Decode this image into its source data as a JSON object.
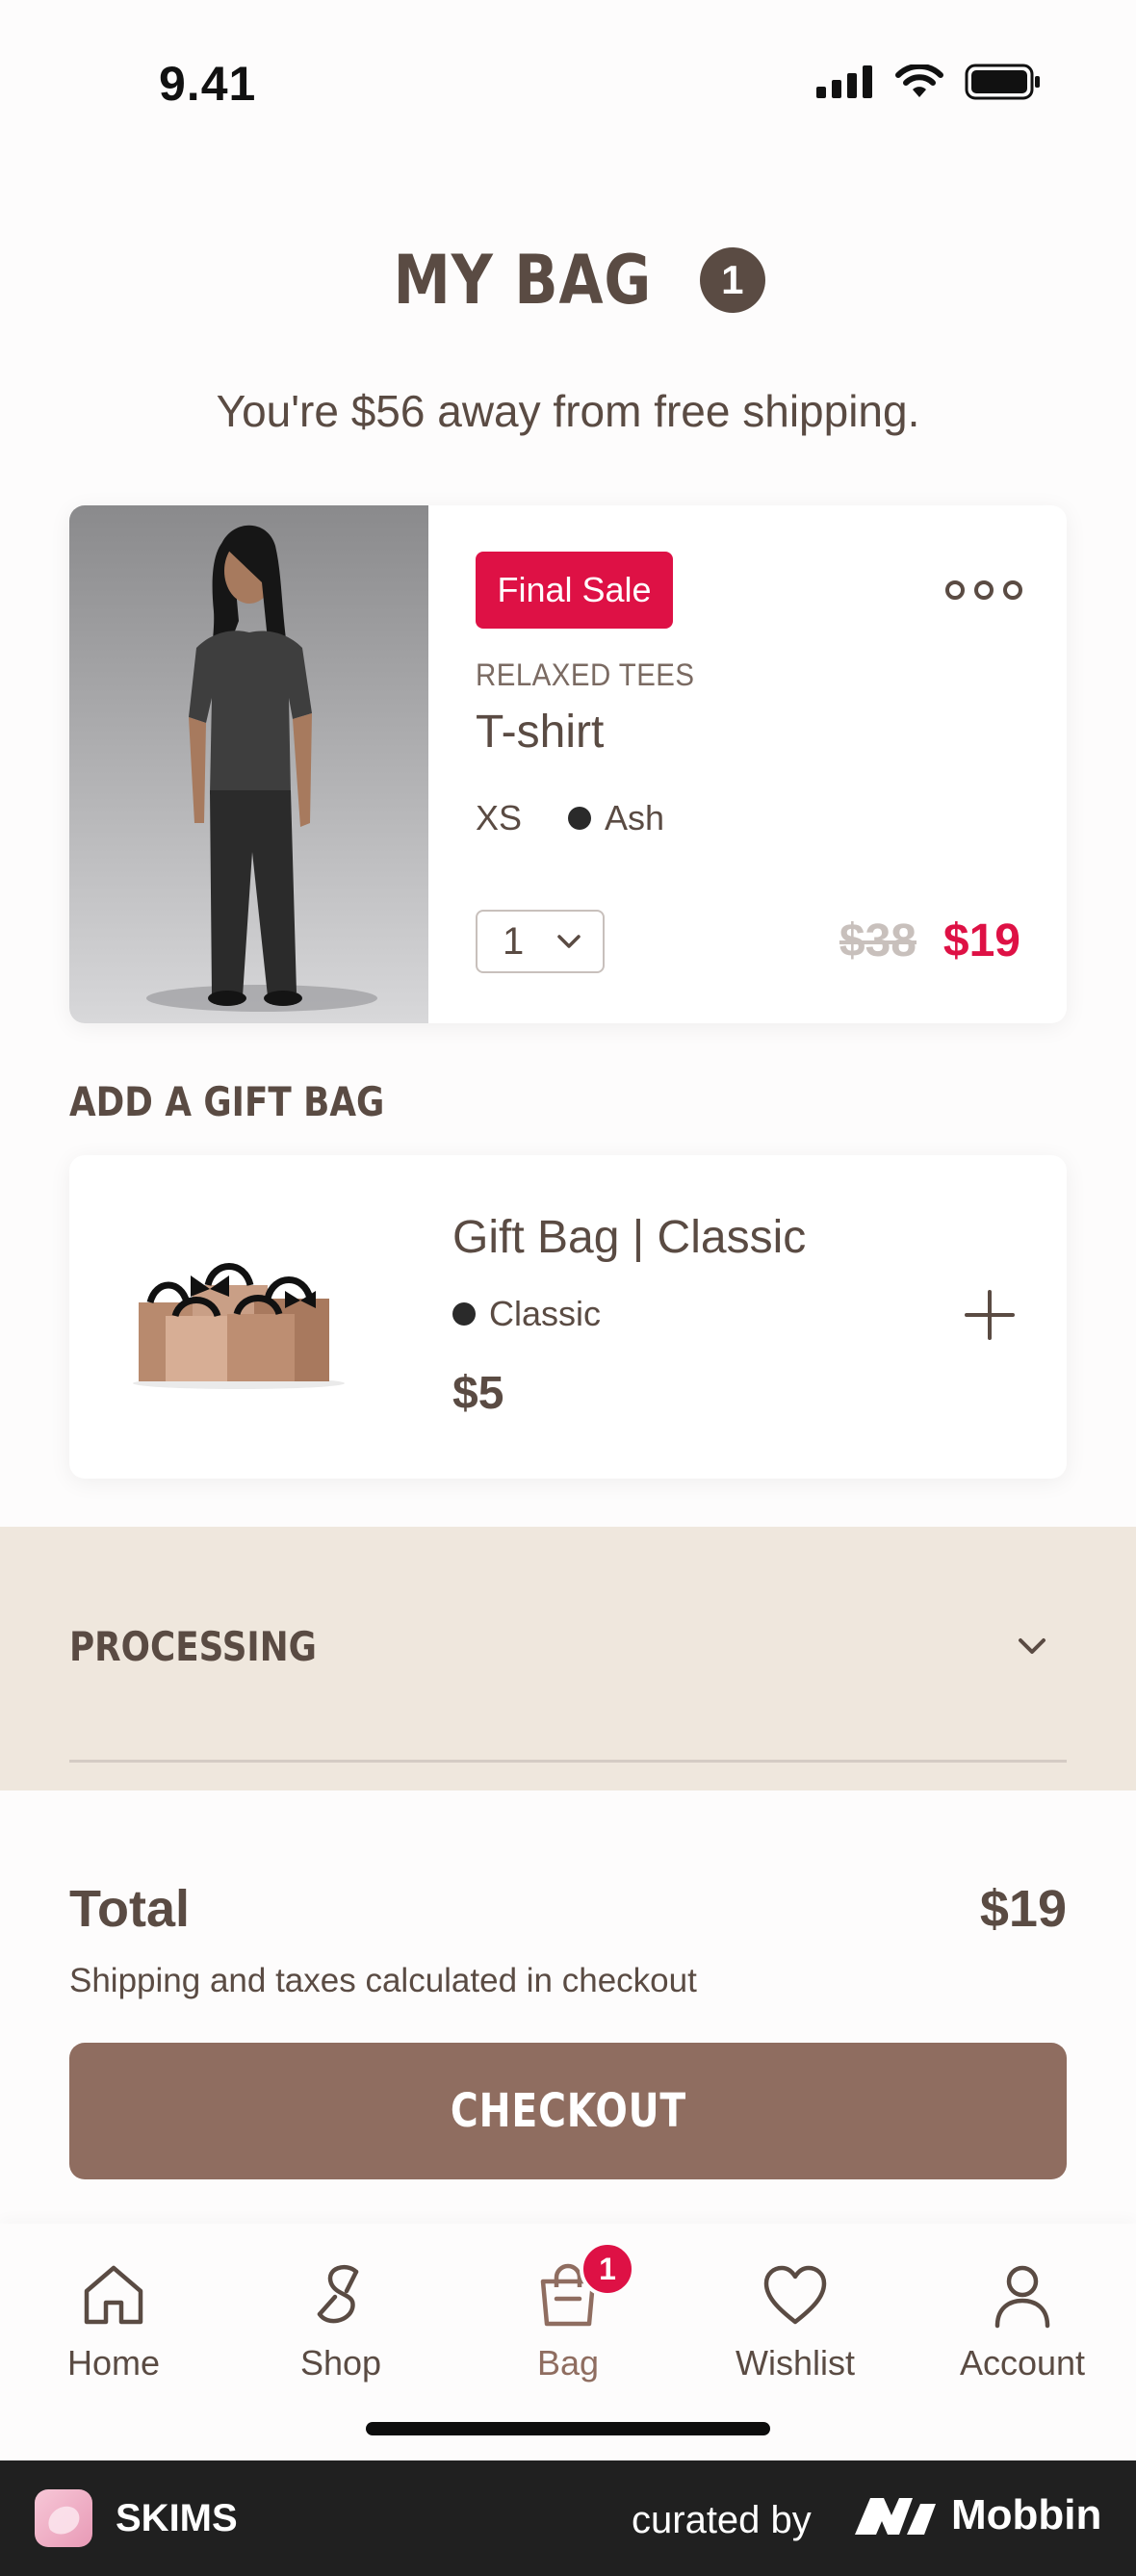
{
  "status_bar": {
    "time": "9.41"
  },
  "header": {
    "title": "MY BAG",
    "count": "1"
  },
  "shipping_message": "You're $56 away from free shipping.",
  "cart_item": {
    "sale_badge": "Final Sale",
    "collection": "RELAXED TEES",
    "name": "T-shirt",
    "size": "XS",
    "color": "Ash",
    "quantity": "1",
    "original_price": "$38",
    "sale_price": "$19"
  },
  "gift_section": {
    "label": "ADD A GIFT BAG",
    "name": "Gift Bag | Classic",
    "variant": "Classic",
    "price": "$5"
  },
  "processing": {
    "label": "PROCESSING"
  },
  "summary": {
    "total_label": "Total",
    "total_value": "$19",
    "note": "Shipping and taxes calculated in checkout"
  },
  "checkout": {
    "label": "CHECKOUT"
  },
  "tabs": [
    {
      "label": "Home",
      "icon": "home-icon"
    },
    {
      "label": "Shop",
      "icon": "shop-icon"
    },
    {
      "label": "Bag",
      "icon": "bag-icon",
      "badge": "1",
      "active": true
    },
    {
      "label": "Wishlist",
      "icon": "heart-icon"
    },
    {
      "label": "Account",
      "icon": "person-icon"
    }
  ],
  "mobbin_bar": {
    "app_name": "SKIMS",
    "curated_by": "curated by",
    "brand": "Mobbin"
  },
  "colors": {
    "text": "#5a4b43",
    "accent_sale": "#de1145",
    "checkout": "#8f6d60",
    "processing_bg": "#efe7dd"
  }
}
